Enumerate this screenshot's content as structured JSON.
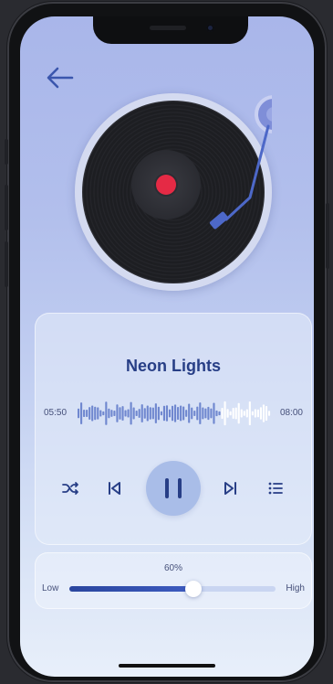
{
  "player": {
    "track_title": "Neon Lights",
    "elapsed": "05:50",
    "duration": "08:00",
    "progress_fraction": 0.73,
    "state": "playing"
  },
  "volume": {
    "percent_label": "60%",
    "level_fraction": 0.6,
    "low_label": "Low",
    "high_label": "High"
  },
  "icons": {
    "back": "arrow-left-icon",
    "shuffle": "shuffle-icon",
    "previous": "skip-previous-icon",
    "play_pause": "pause-icon",
    "next": "skip-next-icon",
    "playlist": "list-icon"
  },
  "colors": {
    "accent": "#273e86",
    "record_label": "#e52a45",
    "waveform_played": "#6f87cf",
    "waveform_unplayed": "#ffffff"
  }
}
